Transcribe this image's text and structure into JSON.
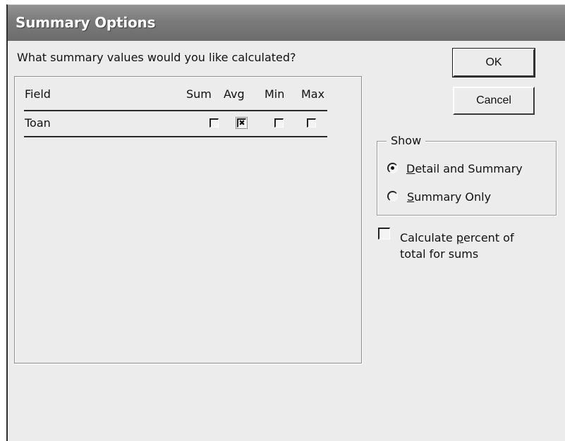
{
  "window": {
    "title": "Summary Options"
  },
  "prompt": "What summary values would you like calculated?",
  "grid": {
    "columns": [
      "Field",
      "Sum",
      "Avg",
      "Min",
      "Max"
    ],
    "rows": [
      {
        "field": "Toan",
        "sum": false,
        "avg": true,
        "min": false,
        "max": false
      }
    ]
  },
  "buttons": {
    "ok": "OK",
    "cancel": "Cancel"
  },
  "show_group": {
    "legend": "Show",
    "options": [
      {
        "label_mnemonic": "D",
        "label_rest": "etail and Summary",
        "selected": true
      },
      {
        "label_mnemonic": "S",
        "label_rest": "ummary Only",
        "selected": false
      }
    ]
  },
  "percent_checkbox": {
    "line1_prefix": "Calculate ",
    "line1_mnemonic": "p",
    "line1_suffix": "ercent of",
    "line2": "total for sums",
    "checked": false
  },
  "colors": {
    "dialog_bg": "#ececec",
    "title_bar": "#7a7a7a",
    "title_text": "#ffffff"
  }
}
